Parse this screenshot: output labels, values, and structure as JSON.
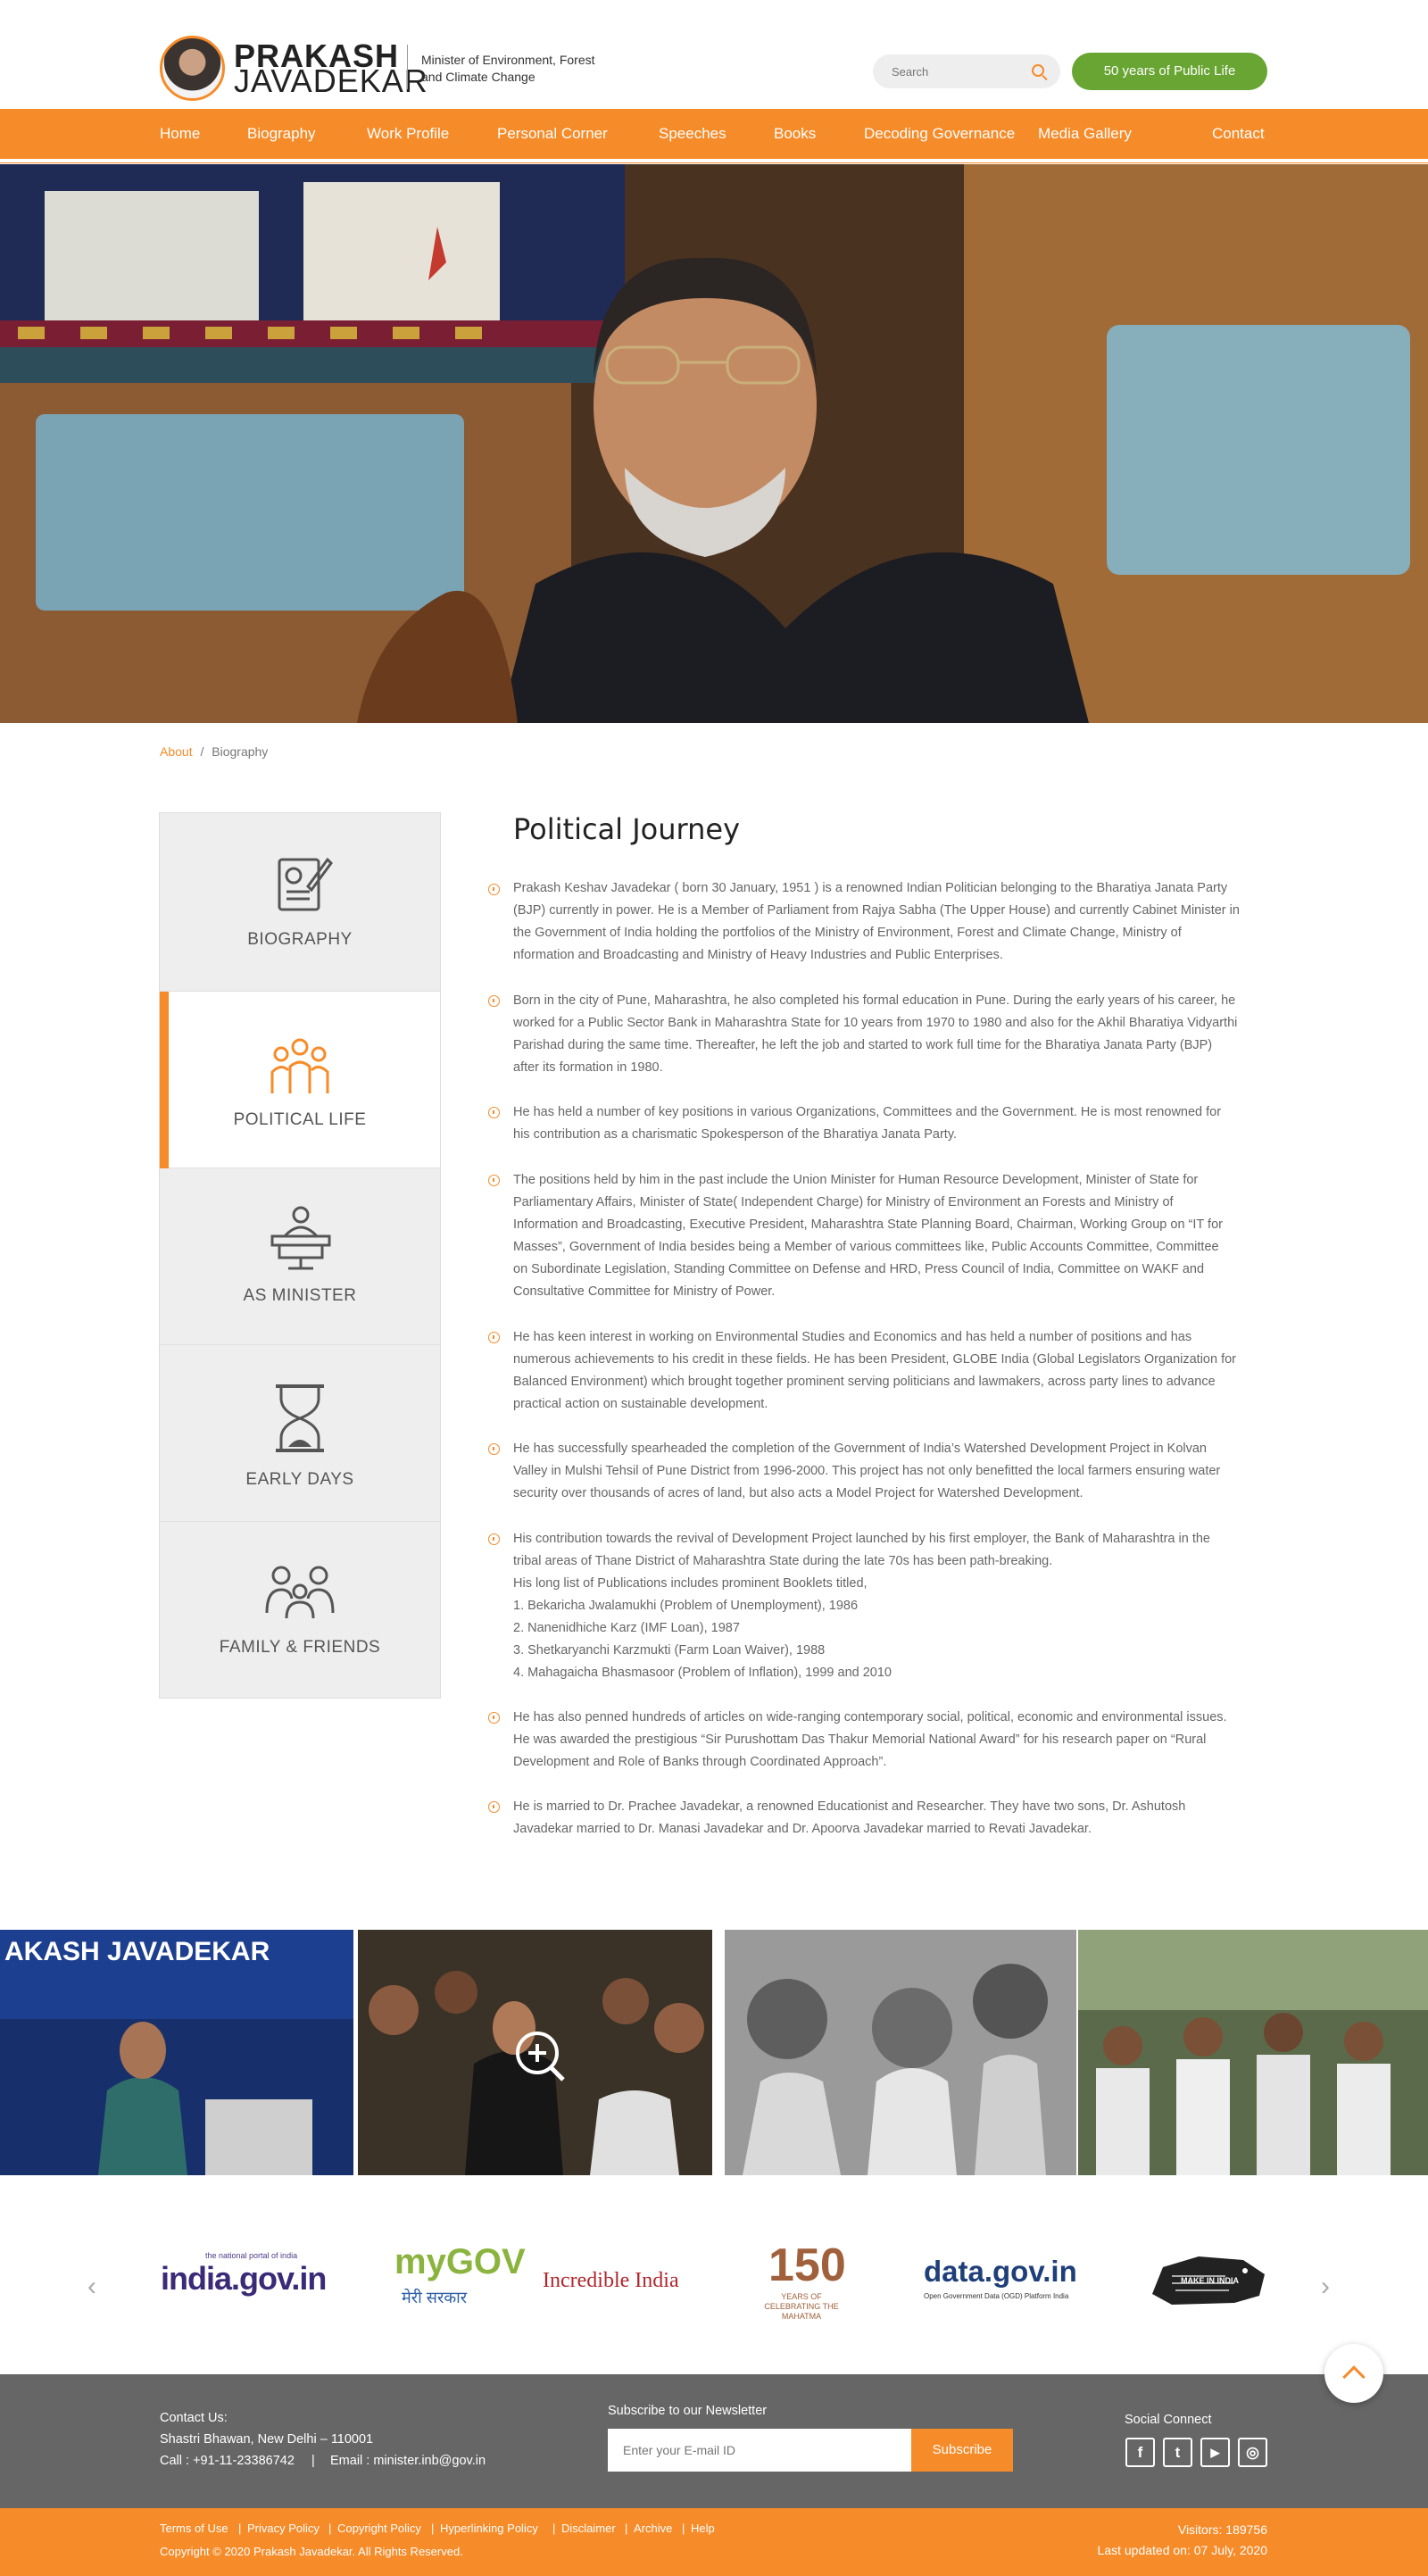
{
  "header": {
    "name_line1": "PRAKASH",
    "name_line2": "JAVADEKAR",
    "tagline": "Minister of Environment, Forest and Climate Change",
    "search_placeholder": "Search",
    "years_button": "50 years of Public Life"
  },
  "nav": {
    "items": [
      "Home",
      "Biography",
      "Work Profile",
      "Personal Corner",
      "Speeches",
      "Books",
      "Decoding Governance",
      "Media Gallery",
      "Contact"
    ]
  },
  "breadcrumb": {
    "parent": "About",
    "separator": "/",
    "current": "Biography"
  },
  "side_tabs": [
    "BIOGRAPHY",
    "POLITICAL LIFE",
    "AS MINISTER",
    "EARLY DAYS",
    "FAMILY & FRIENDS"
  ],
  "content": {
    "title": "Political Journey",
    "paragraphs": [
      [
        "Prakash Keshav Javadekar ( born 30 January, 1951 ) is a renowned Indian Politician belonging to the Bharatiya Janata Party",
        "(BJP) currently in power. He is a Member of Parliament from Rajya Sabha (The Upper House) and currently Cabinet Minister in",
        "the Government of India holding the portfolios of the Ministry of Environment, Forest and Climate Change, Ministry of",
        "nformation and Broadcasting and Ministry of Heavy Industries and Public Enterprises."
      ],
      [
        "Born in the city of Pune, Maharashtra, he also completed his formal education in Pune. During the early years of his career, he",
        "worked for a Public Sector Bank in Maharashtra State for 10 years from 1970 to 1980 and also for the Akhil Bharatiya Vidyarthi",
        "Parishad during the same time. Thereafter, he left the job and started to work full time for the Bharatiya Janata Party (BJP)",
        "after its formation in 1980."
      ],
      [
        "He has held a number of key positions in various Organizations, Committees and the Government. He is most renowned for",
        "his contribution as a charismatic Spokesperson of the Bharatiya Janata Party."
      ],
      [
        "The positions held by him in the past include the Union Minister for Human Resource Development, Minister of State for",
        "Parliamentary Affairs, Minister of State( Independent Charge) for Ministry of Environment an Forests and Ministry of",
        "Information and Broadcasting, Executive President, Maharashtra State Planning Board, Chairman, Working Group on “IT for",
        "Masses”, Government of India besides being a Member of various committees like, Public Accounts Committee, Committee",
        "on Subordinate Legislation, Standing Committee on Defense and HRD, Press Council of India, Committee on WAKF and",
        "Consultative Committee for Ministry of Power."
      ],
      [
        "He has keen interest in working on Environmental Studies and Economics and has held a number of positions and has",
        "numerous achievements to his credit in these fields. He has been President, GLOBE India (Global Legislators Organization for",
        "Balanced Environment) which brought together prominent serving politicians and lawmakers, across party lines to advance",
        "practical action on sustainable development."
      ],
      [
        "He has successfully spearheaded the completion of the Government of India’s Watershed Development Project in Kolvan",
        "Valley in Mulshi Tehsil of Pune District from 1996-2000. This project has not only benefitted the local farmers ensuring water",
        "security over thousands of acres of land, but also acts a Model Project for Watershed Development."
      ],
      [
        "His contribution towards the revival of Development Project launched by his first employer, the Bank of Maharashtra in the",
        "tribal areas of Thane District of Maharashtra State during the late 70s has been path-breaking.",
        "His long list of Publications includes prominent Booklets titled,",
        "1. Bekaricha Jwalamukhi (Problem of Unemployment), 1986",
        "2. Nanenidhiche Karz (IMF Loan), 1987",
        "3. Shetkaryanchi Karzmukti (Farm Loan Waiver), 1988",
        "4. Mahagaicha Bhasmasoor (Problem of Inflation), 1999 and 2010"
      ],
      [
        "He has also penned hundreds of articles on wide-ranging contemporary social, political, economic and environmental issues.",
        "He was awarded the prestigious “Sir Purushottam Das Thakur Memorial National Award” for his research paper on “Rural",
        "Development and Role of Banks through Coordinated Approach”."
      ],
      [
        "He is married to Dr. Prachee Javadekar, a renowned Educationist and Researcher. They have two sons, Dr. Ashutosh",
        "Javadekar married to Dr. Manasi Javadekar and Dr. Apoorva Javadekar married to Revati Javadekar."
      ]
    ]
  },
  "gallery": {
    "banner_text": "AKASH JAVADEKAR"
  },
  "partners": [
    {
      "name": "india.gov.in",
      "sub": "the national portal of india"
    },
    {
      "name": "myGOV",
      "sub": "मेरी सरकार"
    },
    {
      "name": "Incredible India"
    },
    {
      "name": "150",
      "sub": "YEARS OF CELEBRATING THE MAHATMA"
    },
    {
      "name": "data.gov.in",
      "sub": "Open Government Data (OGD) Platform India"
    },
    {
      "name": "MAKE IN INDIA"
    }
  ],
  "footer": {
    "contact_heading": "Contact Us:",
    "address": "Shastri Bhawan, New Delhi – 110001",
    "call": "Call : +91-11-23386742",
    "divider": "|",
    "email": "Email : minister.inb@gov.in",
    "newsletter_heading": "Subscribe to our Newsletter",
    "email_placeholder": "Enter your E-mail ID",
    "subscribe_button": "Subscribe",
    "social_heading": "Social Connect",
    "social_icons": [
      "f",
      "t",
      "▶",
      "◎"
    ]
  },
  "bottom": {
    "links": [
      "Terms of Use",
      "Privacy Policy",
      "Copyright Policy",
      "Hyperlinking Policy",
      "Disclaimer",
      "Archive",
      "Help"
    ],
    "separator": "|",
    "copyright": "Copyright © 2020 Prakash Javadekar. All Rights Reserved.",
    "visitors": "Visitors: 189756",
    "last_updated": "Last updated on: 07 July, 2020"
  },
  "colors": {
    "accent": "#f68b29",
    "green": "#68a532",
    "footer": "#666666"
  }
}
